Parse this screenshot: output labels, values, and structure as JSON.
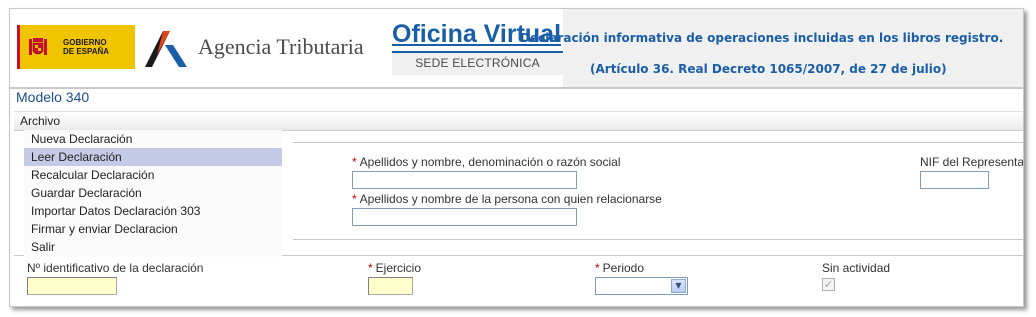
{
  "header": {
    "gov_logo_text": "GOBIERNO DE ESPAÑA",
    "gov_logo_line1": "GOBIERNO",
    "gov_logo_line2": "DE ESPAÑA",
    "agency_name": "Agencia Tributaria",
    "portal_title": "Oficina Virtual",
    "portal_subtitle": "SEDE ELECTRÓNICA",
    "heading_line1": "Declaración informativa de operaciones incluidas en los libros registro.",
    "heading_line2": "(Artículo 36. Real Decreto 1065/2007, de 27 de julio)"
  },
  "model_title": "Modelo 340",
  "menu": {
    "label": "Archivo",
    "items": [
      {
        "label": "Nueva Declaración"
      },
      {
        "label": "Leer Declaración"
      },
      {
        "label": "Recalcular Declaración"
      },
      {
        "label": "Guardar Declaración"
      },
      {
        "label": "Importar Datos Declaración 303"
      },
      {
        "label": "Firmar y enviar Declaracion"
      },
      {
        "label": "Salir"
      }
    ],
    "selected_index": 1
  },
  "form": {
    "required_marker": "*",
    "apellidos_label": "Apellidos y nombre, denominación o razón social",
    "apellidos_value": "",
    "nif_representante_label": "NIF del Representa",
    "nif_representante_value": "",
    "relacion_label": "Apellidos y nombre de la persona con quien relacionarse",
    "relacion_value": "",
    "num_identificativo_label": "Nº identificativo de la declaración",
    "num_identificativo_value": "",
    "ejercicio_label": "Ejercicio",
    "ejercicio_value": "",
    "periodo_label": "Periodo",
    "periodo_value": "",
    "sin_actividad_label": "Sin actividad",
    "sin_actividad_checked": true
  },
  "colors": {
    "accent_blue": "#1b5ea8",
    "menu_highlight": "#c5cbe6",
    "required_red": "#cc0000",
    "input_yellow": "#ffffcc",
    "logo_yellow": "#f1c400"
  }
}
